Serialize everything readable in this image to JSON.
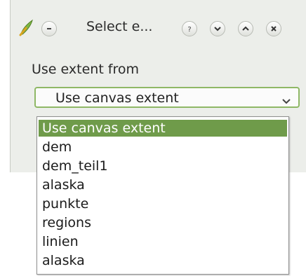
{
  "window": {
    "title": "Select e...",
    "app_icon": "qgis-icon",
    "buttons": [
      "menu-icon",
      "help-icon",
      "minimize-icon",
      "maximize-icon",
      "close-icon"
    ]
  },
  "form": {
    "label": "Use extent from",
    "combo_value": "Use canvas extent"
  },
  "dropdown": {
    "options": [
      {
        "label": "Use canvas extent",
        "selected": true
      },
      {
        "label": "dem",
        "selected": false
      },
      {
        "label": "dem_teil1",
        "selected": false
      },
      {
        "label": "alaska",
        "selected": false
      },
      {
        "label": "punkte",
        "selected": false
      },
      {
        "label": "regions",
        "selected": false
      },
      {
        "label": "linien",
        "selected": false
      },
      {
        "label": "alaska",
        "selected": false
      }
    ]
  },
  "colors": {
    "accent": "#6f9b4a",
    "combo_border": "#8fb866",
    "window_bg": "#eceeea"
  }
}
